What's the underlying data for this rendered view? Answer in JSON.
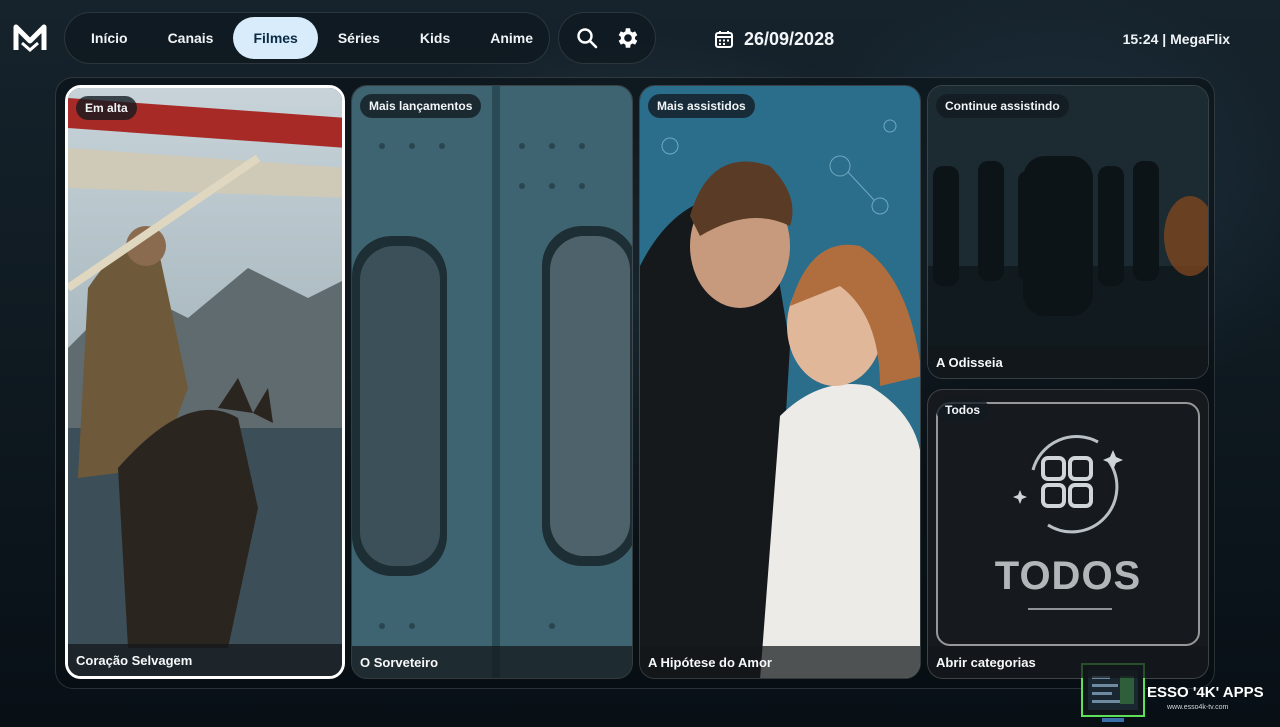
{
  "app": {
    "logo_letter": "M",
    "name": "MegaFlix"
  },
  "nav": {
    "items": [
      {
        "label": "Início",
        "active": false
      },
      {
        "label": "Canais",
        "active": false
      },
      {
        "label": "Filmes",
        "active": true
      },
      {
        "label": "Séries",
        "active": false
      },
      {
        "label": "Kids",
        "active": false
      },
      {
        "label": "Anime",
        "active": false
      }
    ]
  },
  "tools": {
    "search_icon": "search-icon",
    "settings_icon": "gear-icon"
  },
  "header": {
    "date": "26/09/2028",
    "clock": "15:24 | MegaFlix"
  },
  "cards": [
    {
      "tag": "Em alta",
      "title": "Coração Selvagem"
    },
    {
      "tag": "Mais lançamentos",
      "title": "O Sorveteiro"
    },
    {
      "tag": "Mais assistidos",
      "title": "A Hipótese do Amor"
    },
    {
      "tag": "Continue assistindo",
      "title": "A Odisseia"
    },
    {
      "tag": "Todos",
      "title": "Abrir categorias",
      "art_text": "TODOS"
    }
  ],
  "watermark": {
    "text": "ESSO '4K' APPS",
    "sub": "www.esso4k-tv.com"
  },
  "colors": {
    "active_tab": "#d8ecfb",
    "focus_border": "#ffffff",
    "accent_green": "#5fe05a"
  }
}
